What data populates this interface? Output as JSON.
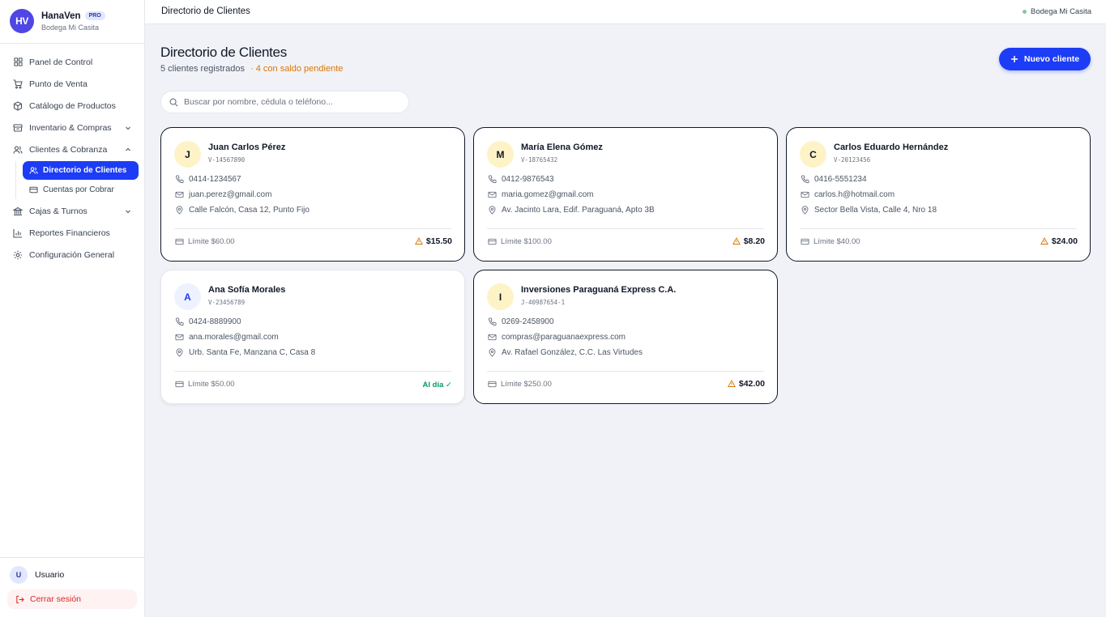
{
  "brand": {
    "initials": "HV",
    "name": "HanaVen",
    "badge": "PRO",
    "store": "Bodega Mi Casita"
  },
  "nav": {
    "items": [
      {
        "label": "Panel de Control",
        "icon": "grid-icon"
      },
      {
        "label": "Punto de Venta",
        "icon": "cart-icon"
      },
      {
        "label": "Catálogo de Productos",
        "icon": "box-icon"
      },
      {
        "label": "Inventario & Compras",
        "icon": "database-icon"
      },
      {
        "label": "Clientes & Cobranza",
        "icon": "users-icon"
      },
      {
        "label": "Cajas & Turnos",
        "icon": "bank-icon"
      },
      {
        "label": "Reportes Financieros",
        "icon": "bar-chart-icon"
      },
      {
        "label": "Configuración General",
        "icon": "gear-icon"
      }
    ],
    "sub": [
      {
        "label": "Directorio de Clientes",
        "active": true
      },
      {
        "label": "Cuentas por Cobrar",
        "active": false
      }
    ]
  },
  "user": {
    "initial": "U",
    "name": "Usuario",
    "logout": "Cerrar sesión"
  },
  "topbar": {
    "title": "Directorio de Clientes",
    "store": "Bodega Mi Casita"
  },
  "page": {
    "title": "Directorio de Clientes",
    "count": "5 clientes registrados",
    "pending": "· 4 con saldo pendiente",
    "new_button": "Nuevo cliente",
    "search_placeholder": "Buscar por nombre, cédula o teléfono..."
  },
  "clients": [
    {
      "initial": "J",
      "name": "Juan Carlos Pérez",
      "id": "V-14567890",
      "phone": "0414-1234567",
      "email": "juan.perez@gmail.com",
      "address": "Calle Falcón, Casa 12, Punto Fijo",
      "limit": "Límite $60.00",
      "balance": "$15.50"
    },
    {
      "initial": "M",
      "name": "María Elena Gómez",
      "id": "V-18765432",
      "phone": "0412-9876543",
      "email": "maria.gomez@gmail.com",
      "address": "Av. Jacinto Lara, Edif. Paraguaná, Apto 3B",
      "limit": "Límite $100.00",
      "balance": "$8.20"
    },
    {
      "initial": "C",
      "name": "Carlos Eduardo Hernández",
      "id": "V-20123456",
      "phone": "0416-5551234",
      "email": "carlos.h@hotmail.com",
      "address": "Sector Bella Vista, Calle 4, Nro 18",
      "limit": "Límite $40.00",
      "balance": "$24.00"
    },
    {
      "initial": "A",
      "name": "Ana Sofía Morales",
      "id": "V-23456789",
      "phone": "0424-8889900",
      "email": "ana.morales@gmail.com",
      "address": "Urb. Santa Fe, Manzana C, Casa 8",
      "limit": "Límite $50.00",
      "status": "Al día ✓"
    },
    {
      "initial": "I",
      "name": "Inversiones Paraguaná Express C.A.",
      "id": "J-40987654-1",
      "phone": "0269-2458900",
      "email": "compras@paraguanaexpress.com",
      "address": "Av. Rafael González, C.C. Las Virtudes",
      "limit": "Límite $250.00",
      "balance": "$42.00"
    }
  ],
  "colors": {
    "accent": "#1d3cf5",
    "warning": "#d97706",
    "ok": "#059669",
    "danger": "#dc2626"
  }
}
